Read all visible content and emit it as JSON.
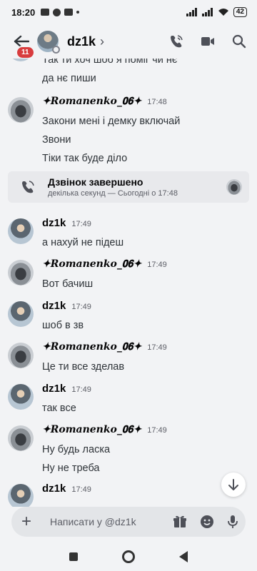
{
  "status_bar": {
    "time": "18:20",
    "battery": "42",
    "left_icons": [
      "video-icon",
      "snapchat-icon",
      "gamepad-icon",
      "dot-icon"
    ],
    "right_icons": [
      "signal-icon",
      "signal-icon",
      "wifi-icon",
      "battery-icon"
    ]
  },
  "header": {
    "unread_count": "11",
    "name": "dz1k",
    "chevron": "›",
    "actions": [
      "phone-call-icon",
      "video-call-icon",
      "search-icon"
    ]
  },
  "messages": {
    "top_partial": [
      "Так ти хоч шоб я поміг чи нє",
      "да нє пиши"
    ],
    "groups": [
      {
        "user": "✦𝑹𝒐𝒎𝒂𝒏𝒆𝒏𝒌𝒐_𝟎𝟔✦",
        "time": "17:48",
        "lines": [
          "Закони мені і демку включай",
          "Звони",
          "Тіки так буде діло"
        ]
      },
      {
        "user": "dz1k",
        "time": "17:49",
        "lines": [
          "а нахуй не підеш"
        ]
      },
      {
        "user": "✦𝑹𝒐𝒎𝒂𝒏𝒆𝒏𝒌𝒐_𝟎𝟔✦",
        "time": "17:49",
        "lines": [
          "Вот бачиш"
        ]
      },
      {
        "user": "dz1k",
        "time": "17:49",
        "lines": [
          "шоб в зв"
        ]
      },
      {
        "user": "✦𝑹𝒐𝒎𝒂𝒏𝒆𝒏𝒌𝒐_𝟎𝟔✦",
        "time": "17:49",
        "lines": [
          "Це ти все зделав"
        ]
      },
      {
        "user": "dz1k",
        "time": "17:49",
        "lines": [
          "так все"
        ]
      },
      {
        "user": "✦𝑹𝒐𝒎𝒂𝒏𝒆𝒏𝒌𝒐_𝟎𝟔✦",
        "time": "17:49",
        "lines": [
          "Ну будь ласка",
          "Ну не треба"
        ]
      },
      {
        "user": "dz1k",
        "time": "17:49",
        "lines": []
      }
    ],
    "call": {
      "title": "Дзвінок завершено",
      "subtitle": "декілька секунд — Сьогодні о 17:48"
    }
  },
  "composer": {
    "placeholder": "Написати у @dz1k"
  },
  "colors": {
    "accent_red": "#d83c3e",
    "background": "#f2f3f5",
    "composer_bg": "#e3e5e8"
  }
}
